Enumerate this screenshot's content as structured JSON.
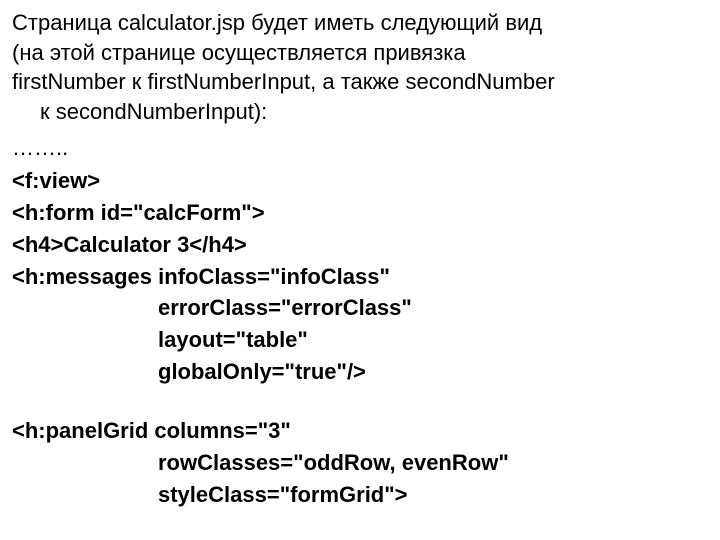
{
  "intro": {
    "line1": "Страница calculator.jsp будет иметь следующий вид",
    "line2": " (на этой странице осуществляется привязка",
    "line3": " firstNumber к firstNumberInput, а также secondNumber",
    "line4": "к secondNumberInput):"
  },
  "dots": "……..",
  "code": {
    "l1": "<f:view>",
    "l2": "<h:form id=\"calcForm\">",
    "l3": "<h4>Calculator 3</h4>",
    "l4": "<h:messages infoClass=\"infoClass\"",
    "l5": "errorClass=\"errorClass\"",
    "l6": "layout=\"table\"",
    "l7": "globalOnly=\"true\"/>",
    "l8": "<h:panelGrid columns=\"3\"",
    "l9": "rowClasses=\"oddRow, evenRow\"",
    "l10": "styleClass=\"formGrid\">"
  }
}
